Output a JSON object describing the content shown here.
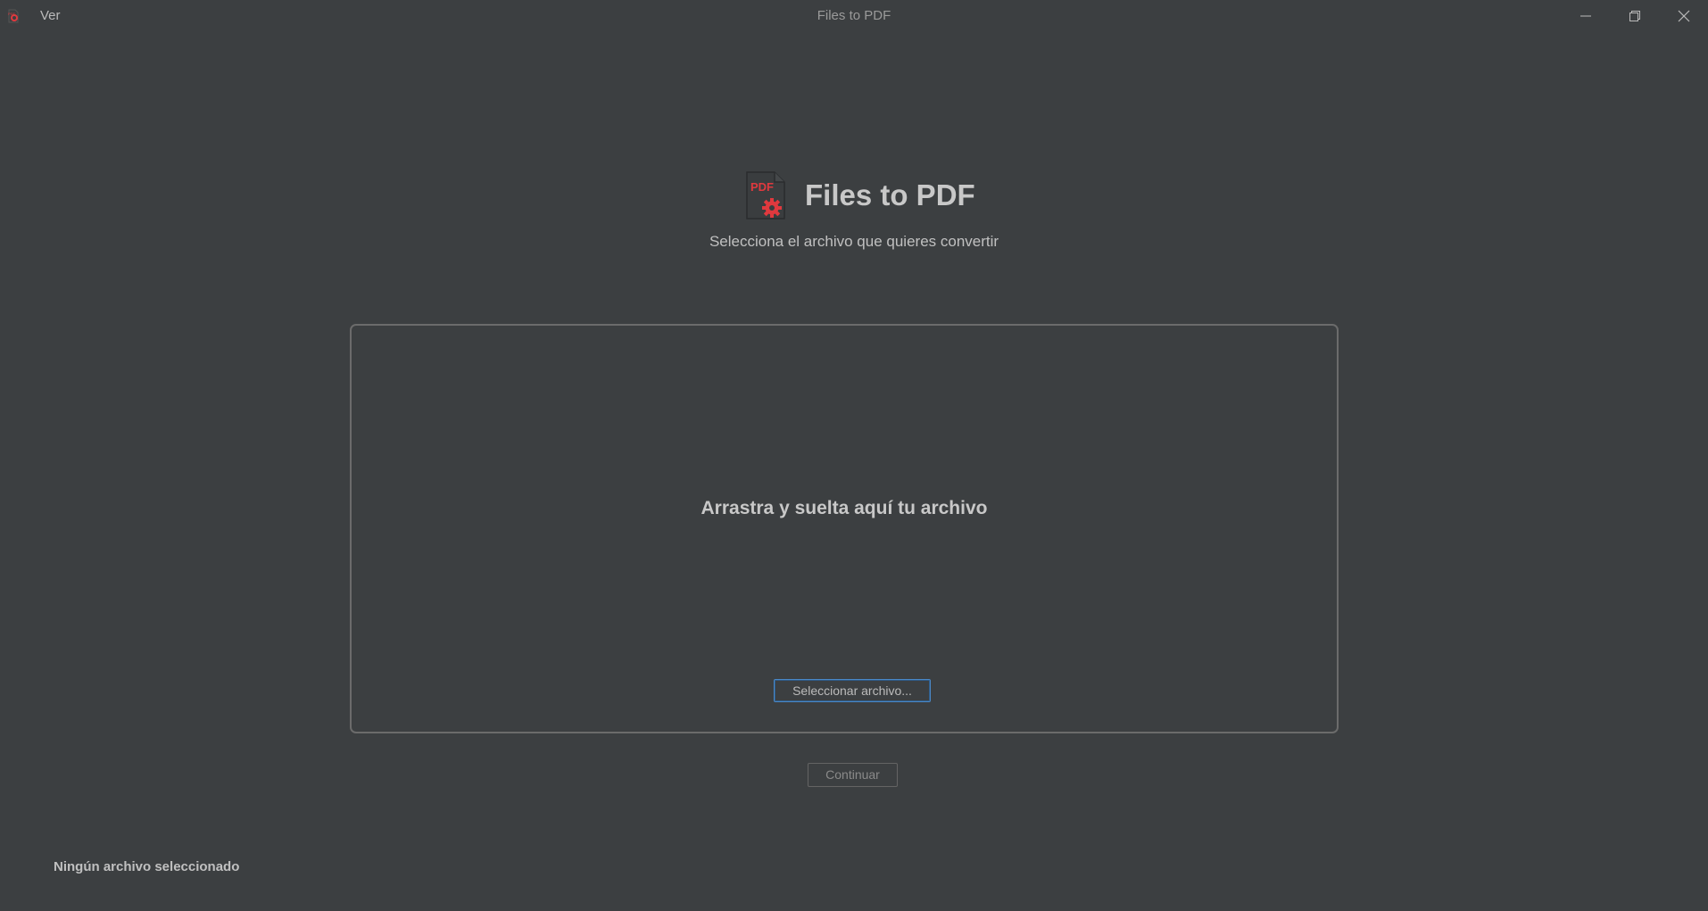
{
  "titlebar": {
    "app_icon": "pdf-gear-icon",
    "menu_label": "Ver",
    "window_title": "Files to PDF",
    "controls": {
      "minimize_icon": "minimize-icon",
      "maximize_icon": "restore-icon",
      "close_icon": "close-icon"
    }
  },
  "header": {
    "logo_icon": "pdf-gear-icon",
    "logo_text": "PDF",
    "title": "Files to PDF",
    "subtitle": "Selecciona el archivo que quieres convertir"
  },
  "drop_zone": {
    "prompt": "Arrastra y suelta aquí tu archivo",
    "select_button_label": "Seleccionar archivo..."
  },
  "actions": {
    "continue_label": "Continuar"
  },
  "status": {
    "text": "Ningún archivo seleccionado"
  },
  "colors": {
    "background": "#3c3f41",
    "accent_red": "#e0393e",
    "focus_blue": "#4a88c7"
  }
}
